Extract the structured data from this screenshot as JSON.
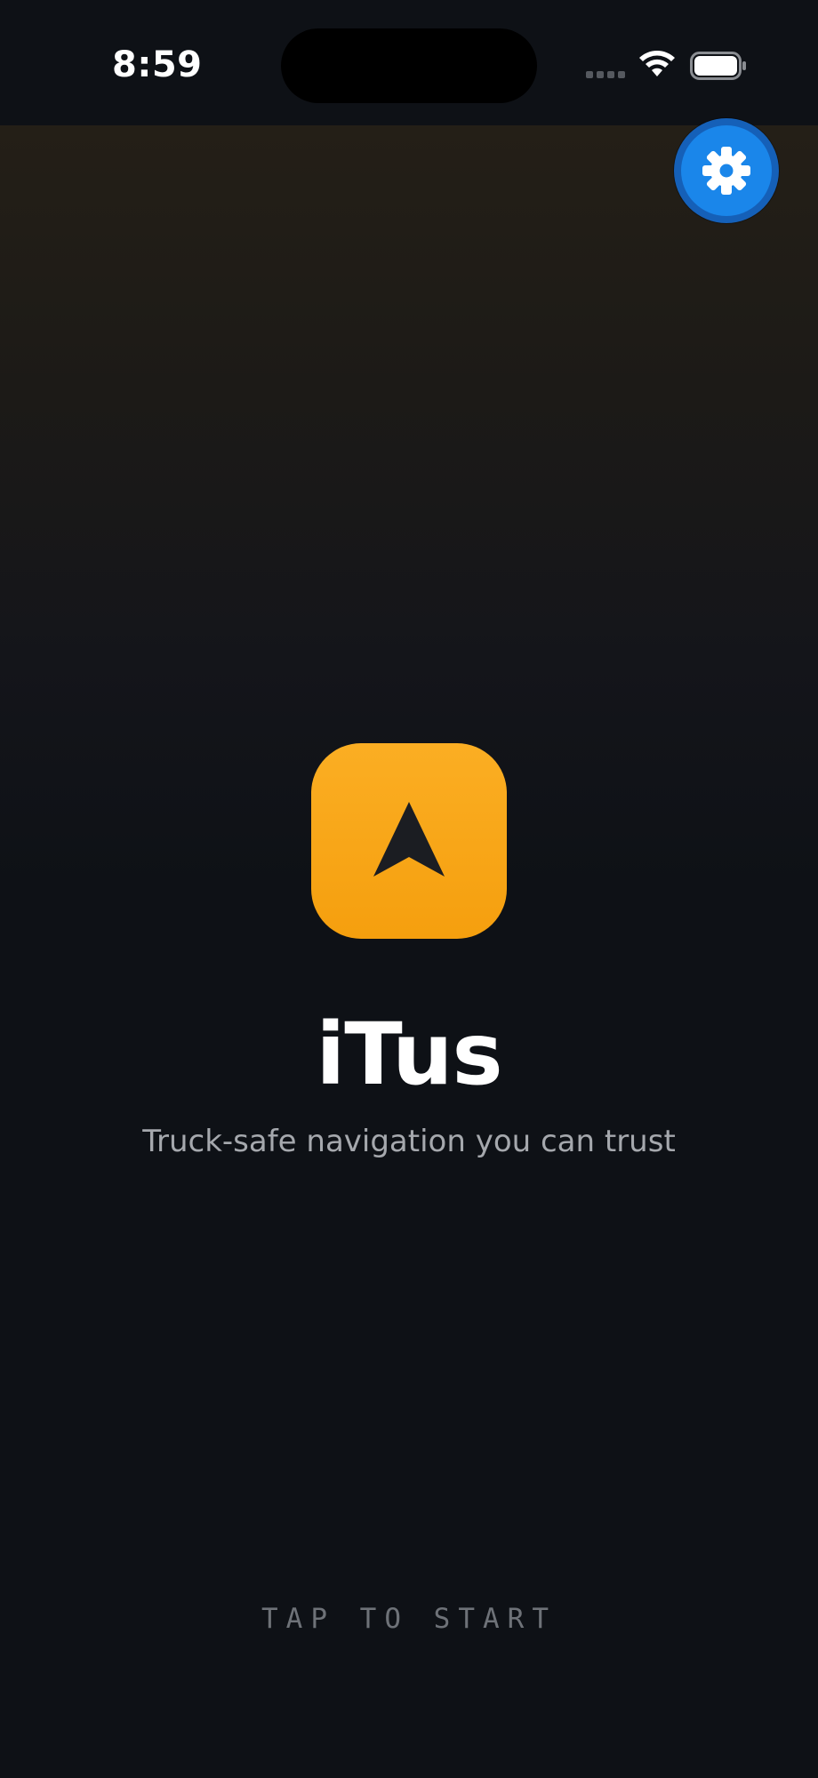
{
  "status_bar": {
    "time": "8:59",
    "wifi_icon": "wifi-icon",
    "battery_icon": "battery-icon",
    "signal_icon": "cellular-signal-icon"
  },
  "settings": {
    "icon": "gear-icon",
    "color": "#1a86ea"
  },
  "app": {
    "logo_icon": "navigation-arrow-icon",
    "logo_color": "#f8a718",
    "title": "iTus",
    "tagline": "Truck-safe navigation you can trust"
  },
  "start_prompt": "TAP TO START"
}
